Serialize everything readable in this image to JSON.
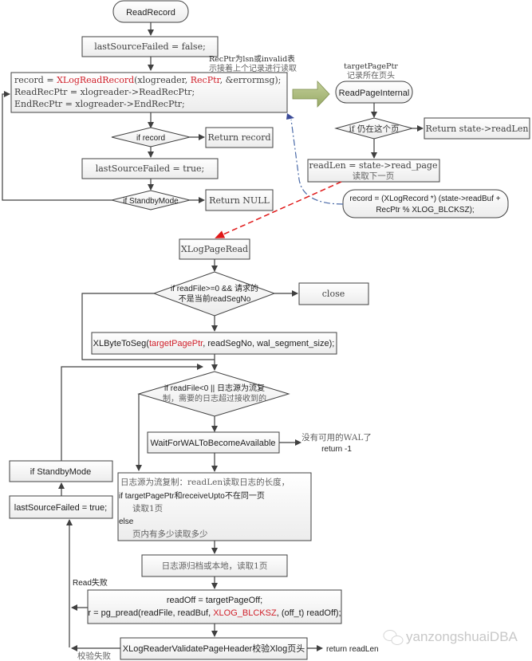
{
  "diagram": {
    "start": "ReadRecord",
    "init": "lastSourceFailed = false;",
    "read_block": {
      "line1_prefix": "record = ",
      "line1_func": "XLogReadRecord",
      "line1_args_a": "(xlogreader, ",
      "line1_arg_red": "RecPtr",
      "line1_args_b": ", &errormsg);",
      "line2": "ReadRecPtr = xlogreader->ReadRecPtr;",
      "line3": "EndRecPtr = xlogreader->EndRecPtr;"
    },
    "recptr_note": [
      "RecPtr为lsn或invalid表",
      "示接着上个记录进行读取"
    ],
    "if_record": "if record",
    "return_record": "Return record",
    "set_failed": "lastSourceFailed = true;",
    "if_standby": "if StandbyMode",
    "return_null": "Return NULL",
    "right": {
      "target_note": [
        "targetPagePtr",
        "记录所在页头"
      ],
      "read_page_internal": "ReadPageInternal",
      "if_same_page": "if 仍在这个页",
      "return_readlen": "Return state->readLen",
      "read_page": [
        "readLen = state->read_page",
        "读取下一页"
      ],
      "record_cast": [
        "record = (XLogRecord *) (state->readBuf +",
        "RecPtr % XLOG_BLCKSZ);"
      ]
    },
    "xlog_page_read": "XLogPageRead",
    "if_readfile": [
      "if readFile>=0 && 请求的",
      "不是当前readSegNo"
    ],
    "close": "close",
    "xlbyte": {
      "prefix": "XLByteToSeg(",
      "red": "targetPagePtr",
      "suffix": ", readSegNo, wal_segment_size);"
    },
    "if_readfile2": [
      "if readFile<0 || 日志源为流复",
      "制，需要的日志超过接收到的"
    ],
    "wait_wal": "WaitForWALToBecomeAvailable",
    "no_wal": [
      "没有可用的WAL了",
      "return -1"
    ],
    "left_standby": "if StandbyMode",
    "left_failed": "lastSourceFailed = true;",
    "stream_block": [
      "日志源为流复制：readLen读取日志的长度，",
      "if targetPagePtr和receiveUpto不在同一页",
      "读取1页",
      "else",
      "页内有多少读取多少"
    ],
    "archive_block": "日志源归档或本地，读取1页",
    "read_fail": "Read失败",
    "pread": {
      "line1": "readOff = targetPageOff;",
      "line2_prefix": "r = pg_pread(readFile, readBuf, ",
      "line2_red": "XLOG_BLCKSZ",
      "line2_suffix": ", (off_t) readOff);"
    },
    "validate": "XLogReaderValidatePageHeader校验Xlog页头",
    "validate_fail": "校验失败",
    "return_readlen_final": "return readLen",
    "watermark": "yanzongshuaiDBA"
  },
  "colors": {
    "accent_red": "#d0202a",
    "dash_blue": "#4a6aa8",
    "arrow_green": "#a9b97a"
  }
}
